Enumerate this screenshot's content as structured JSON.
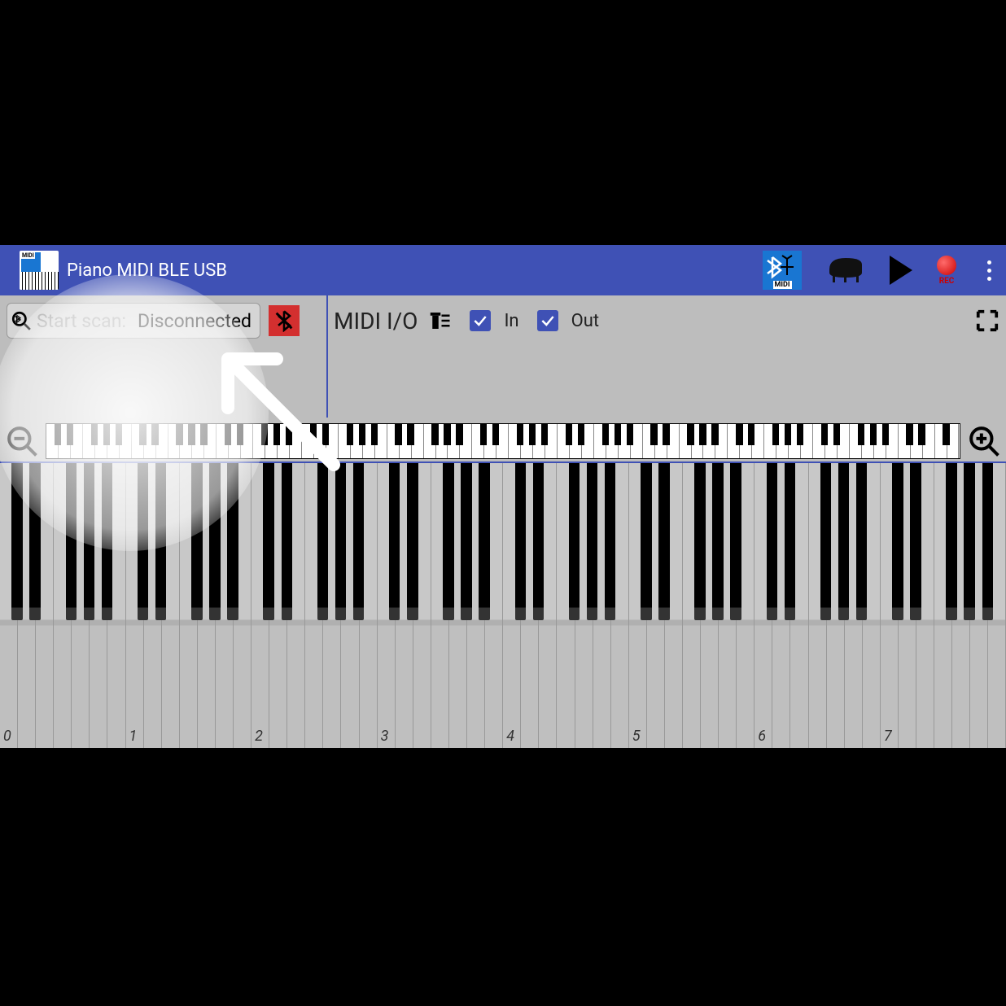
{
  "titlebar": {
    "app_title": "Piano MIDI BLE USB",
    "midi_badge": "MIDI",
    "rec_label": "REC"
  },
  "controls": {
    "scan_label": "Start scan:",
    "scan_status": "Disconnected",
    "midi_io_label": "MIDI I/O",
    "in_label": "In",
    "out_label": "Out",
    "in_checked": true,
    "out_checked": true
  },
  "keyboard": {
    "octave_labels": [
      "0",
      "1",
      "2",
      "3",
      "4",
      "5",
      "6",
      "7"
    ],
    "mini_white_count": 75,
    "main_white_count": 56
  }
}
